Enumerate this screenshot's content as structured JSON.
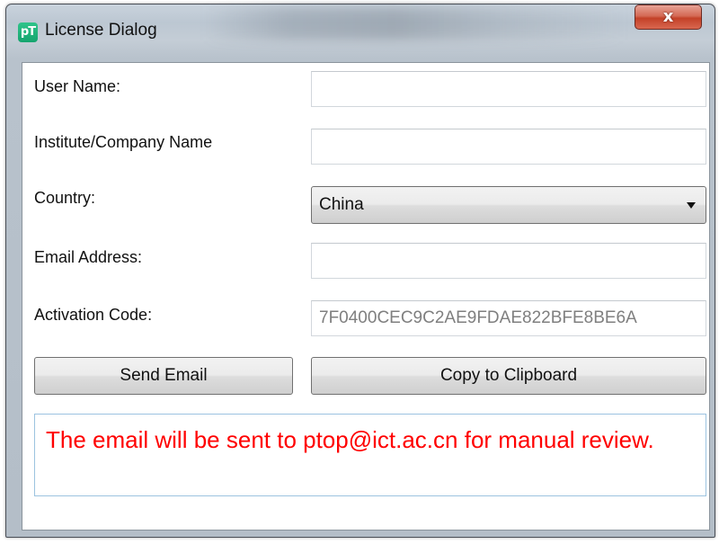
{
  "window": {
    "app_icon_text": "pT",
    "title": "License Dialog",
    "close_label": "x"
  },
  "form": {
    "user_name": {
      "label": "User Name:",
      "value": ""
    },
    "institute": {
      "label": "Institute/Company Name",
      "value": ""
    },
    "country": {
      "label": "Country:",
      "selected": "China"
    },
    "email": {
      "label": "Email Address:",
      "value": ""
    },
    "activation_code": {
      "label": "Activation Code:",
      "value": "7F0400CEC9C2AE9FDAE822BFE8BE6A"
    }
  },
  "buttons": {
    "send_email": "Send Email",
    "copy_clipboard": "Copy to Clipboard"
  },
  "message": {
    "text": "The email will be sent to ptop@ict.ac.cn for manual review.",
    "color": "#ff0000"
  }
}
